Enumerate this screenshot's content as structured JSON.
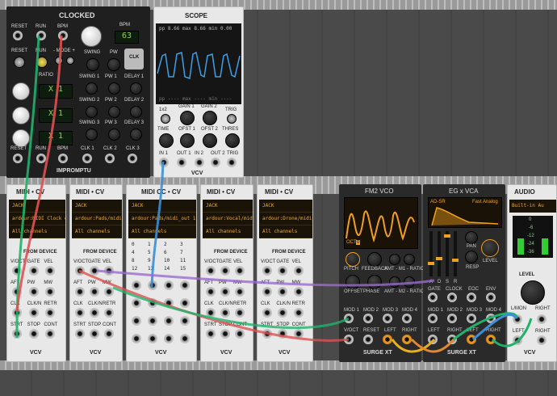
{
  "clocked": {
    "title": "CLOCKED",
    "bpm_label": "BPM",
    "bpm_value": "63",
    "top_labels": [
      "RESET",
      "RUN",
      "BPM"
    ],
    "row2_labels": [
      "RESET",
      "RUN",
      "- MODE +"
    ],
    "swing_label": "SWING",
    "pw_label": "PW",
    "clk_label": "CLK",
    "ratio_label": "RATIO",
    "ratio_displays": [
      "X 1",
      "X 1",
      "X 1"
    ],
    "sub_rows": [
      {
        "swing": "SWING 1",
        "pw": "PW 1",
        "delay": "DELAY 1"
      },
      {
        "swing": "SWING 2",
        "pw": "PW 2",
        "delay": "DELAY 2"
      },
      {
        "swing": "SWING 3",
        "pw": "PW 3",
        "delay": "DELAY 3"
      }
    ],
    "bottom_labels": [
      "RESET",
      "RUN",
      "BPM",
      "CLK 1",
      "CLK 2",
      "CLK 3"
    ],
    "brand": "IMPROMPTU"
  },
  "scope": {
    "title": "SCOPE",
    "top_readout": [
      "pp",
      "8.66",
      "max",
      "8.66",
      "min",
      "0.00"
    ],
    "bottom_readout": [
      "pp",
      "----",
      "max",
      "----",
      "min",
      "----"
    ],
    "labels": [
      "1x2",
      "GAIN 1",
      "GAIN 2",
      "TRIG",
      "TIME",
      "OFST 1",
      "OFST 2",
      "THRES",
      "IN 1",
      "OUT 1",
      "IN 2",
      "OUT 2",
      "TRIG"
    ],
    "brand": "VCV"
  },
  "midi_modules": [
    {
      "title": "MIDI • CV",
      "driver": "JACK",
      "device": "ardour:MIDI Clock o",
      "channel": "All channels",
      "from": "FROM DEVICE",
      "jacks": [
        "V/OCT",
        "GATE",
        "VEL",
        "AFT",
        "PW",
        "MW",
        "CLK",
        "CLK/N",
        "RETR",
        "STRT",
        "STOP",
        "CONT"
      ]
    },
    {
      "title": "MIDI • CV",
      "driver": "JACK",
      "device": "ardour:Pads/midi_o",
      "channel": "All channels",
      "from": "FROM DEVICE",
      "jacks": [
        "V/OCT",
        "GATE",
        "VEL",
        "AFT",
        "PW",
        "MW",
        "CLK",
        "CLK/N",
        "RETR",
        "STRT",
        "STOP",
        "CONT"
      ]
    },
    {
      "title": "MIDI CC • CV",
      "driver": "JACK",
      "device": "ardour:Pads/midi_out 1",
      "channel": "All channels",
      "from": "",
      "grid": [
        "0",
        "1",
        "2",
        "3",
        "4",
        "5",
        "6",
        "7",
        "8",
        "9",
        "10",
        "11",
        "12",
        "13",
        "14",
        "15"
      ]
    },
    {
      "title": "MIDI • CV",
      "driver": "JACK",
      "device": "ardour:Vocal/midi_o",
      "channel": "All channels",
      "from": "FROM DEVICE",
      "jacks": [
        "V/OCT",
        "GATE",
        "VEL",
        "AFT",
        "PW",
        "MW",
        "CLK",
        "CLK/N",
        "RETR",
        "STRT",
        "STOP",
        "CONT"
      ]
    },
    {
      "title": "MIDI • CV",
      "driver": "JACK",
      "device": "ardour:Drone/midi_o",
      "channel": "All channels",
      "from": "FROM DEVICE",
      "jacks": [
        "V/OCT",
        "GATE",
        "VEL",
        "AFT",
        "PW",
        "MW",
        "CLK",
        "CLK/N",
        "RETR",
        "STRT",
        "STOP",
        "CONT"
      ]
    }
  ],
  "fm2": {
    "title": "FM2 VCO",
    "oct_label": "OCT",
    "oct_value": "0",
    "knobs": [
      "PITCH",
      "FEEDBACK",
      "AMT - M1 - RATIO"
    ],
    "knobs2": [
      "OFFSET",
      "PHASE",
      "AMT - M2 - RATIO"
    ],
    "jacks1": [
      "MOD 1",
      "MOD 2",
      "MOD 3",
      "MOD 4"
    ],
    "jacks2": [
      "V/OCT",
      "RESET",
      "LEFT",
      "RIGHT"
    ],
    "brand": "SURGE XT"
  },
  "egvca": {
    "title": "EG x VCA",
    "mode": "AD-SR",
    "preset": "Fast Analog",
    "sliders": [
      "A",
      "D",
      "S",
      "R"
    ],
    "labels": [
      "PAN",
      "RESP",
      "LEVEL",
      "GATE",
      "CLOCK",
      "EOC",
      "ENV"
    ],
    "jacks1": [
      "MOD 1",
      "MOD 2",
      "MOD 3",
      "MOD 4"
    ],
    "jacks2": [
      "LEFT",
      "RIGHT",
      "LEFT",
      "RIGHT"
    ],
    "brand": "SURGE XT"
  },
  "audio": {
    "title": "AUDIO",
    "device": "Built-in Au",
    "meter": [
      "0",
      "-6",
      "-12",
      "-24",
      "-36"
    ],
    "level_label": "LEVEL",
    "jacks": [
      "L/MON",
      "RIGHT",
      "LEFT",
      "RIGHT"
    ],
    "brand": "VCV"
  },
  "cable_colors": {
    "green": "#1fb36b",
    "red": "#e05050",
    "blue": "#3a8fd8",
    "purple": "#9a6ad0",
    "yellow": "#e8b020",
    "orange": "#e08a30"
  }
}
